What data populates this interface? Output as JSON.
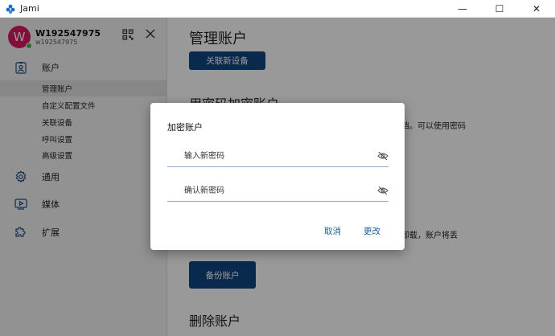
{
  "window": {
    "title": "Jami",
    "minimize_glyph": "—",
    "maximize_glyph": "☐",
    "close_glyph": "✕"
  },
  "profile": {
    "avatar_letter": "W",
    "name": "W192547975",
    "id": "w192547975"
  },
  "sidebar": {
    "account_label": "账户",
    "account_subitems": [
      {
        "label": "管理账户",
        "active": true
      },
      {
        "label": "自定义配置文件",
        "active": false
      },
      {
        "label": "关联设备",
        "active": false
      },
      {
        "label": "呼叫设置",
        "active": false
      },
      {
        "label": "高级设置",
        "active": false
      }
    ],
    "general_label": "通用",
    "media_label": "媒体",
    "extensions_label": "扩展"
  },
  "main": {
    "page_title": "管理账户",
    "link_device_button": "关联新设备",
    "encrypt_section_title": "用密码加密账户",
    "encrypt_desc_partial": "档。可以使用密码",
    "backup_desc_partial": "卸载，账户将丢",
    "backup_button": "备份账户",
    "delete_section_title": "删除账户"
  },
  "dialog": {
    "title": "加密账户",
    "new_password_placeholder": "输入新密码",
    "confirm_password_placeholder": "确认新密码",
    "cancel_label": "取消",
    "change_label": "更改"
  },
  "colors": {
    "accent": "#104580",
    "avatar": "#d81a60",
    "status_online": "#4caf50",
    "link": "#1e5a96"
  }
}
